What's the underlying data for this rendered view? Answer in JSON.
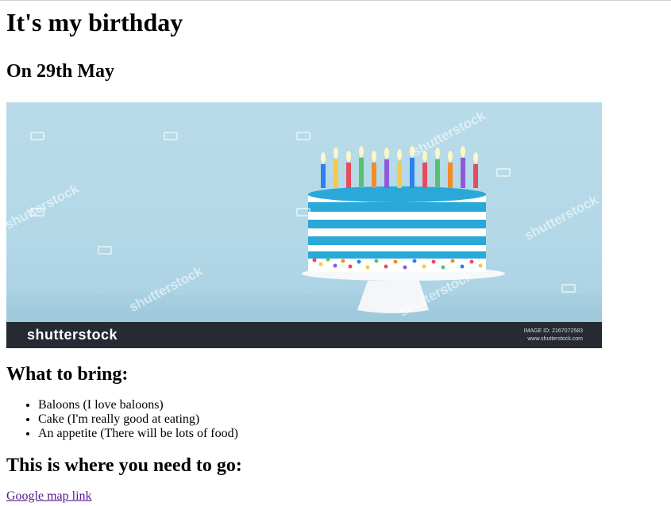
{
  "page": {
    "title": "It's my birthday",
    "date_heading": "On 29th May"
  },
  "photo": {
    "alt": "Birthday cake with candles",
    "brand": "shutterstock",
    "watermark": "shutterstock",
    "image_id": "IMAGE ID: 2167072583",
    "site": "www.shutterstock.com"
  },
  "bring": {
    "heading": "What to bring:",
    "items": [
      "Baloons (I love baloons)",
      "Cake (I'm really good at eating)",
      "An appetite (There will be lots of food)"
    ]
  },
  "directions": {
    "heading": "This is where you need to go:",
    "link_text": "Google map link"
  },
  "colors": {
    "link_visited": "#551a8b",
    "photo_background": "#b9dbe9",
    "frosting_blue": "#2aa8d8",
    "brand_bar": "#252a33"
  }
}
